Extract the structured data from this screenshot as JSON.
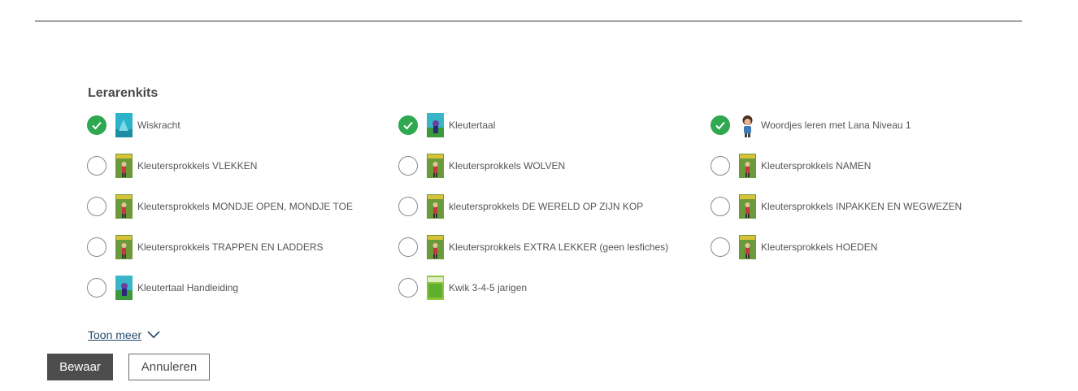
{
  "section": {
    "title": "Lerarenkits"
  },
  "kits": [
    {
      "label": "Wiskracht",
      "checked": true,
      "icon": "wiskracht-cover-icon",
      "cover": "teal"
    },
    {
      "label": "Kleutertaal",
      "checked": true,
      "icon": "kleutertaal-cover-icon",
      "cover": "teal-green"
    },
    {
      "label": "Woordjes leren met Lana Niveau 1",
      "checked": true,
      "icon": "lana-character-icon",
      "cover": "character"
    },
    {
      "label": "Kleutersprokkels VLEKKEN",
      "checked": false,
      "icon": "kleutersprokkels-cover-icon",
      "cover": "sprokkels"
    },
    {
      "label": "Kleutersprokkels WOLVEN",
      "checked": false,
      "icon": "kleutersprokkels-cover-icon",
      "cover": "sprokkels"
    },
    {
      "label": "Kleutersprokkels NAMEN",
      "checked": false,
      "icon": "kleutersprokkels-cover-icon",
      "cover": "sprokkels"
    },
    {
      "label": "Kleutersprokkels MONDJE OPEN, MONDJE TOE",
      "checked": false,
      "icon": "kleutersprokkels-cover-icon",
      "cover": "sprokkels"
    },
    {
      "label": "kleutersprokkels DE WERELD OP ZIJN KOP",
      "checked": false,
      "icon": "kleutersprokkels-cover-icon",
      "cover": "sprokkels"
    },
    {
      "label": "Kleutersprokkels INPAKKEN EN WEGWEZEN",
      "checked": false,
      "icon": "kleutersprokkels-cover-icon",
      "cover": "sprokkels"
    },
    {
      "label": "Kleutersprokkels TRAPPEN EN LADDERS",
      "checked": false,
      "icon": "kleutersprokkels-cover-icon",
      "cover": "sprokkels"
    },
    {
      "label": "Kleutersprokkels EXTRA LEKKER (geen lesfiches)",
      "checked": false,
      "icon": "kleutersprokkels-cover-icon",
      "cover": "sprokkels"
    },
    {
      "label": "Kleutersprokkels HOEDEN",
      "checked": false,
      "icon": "kleutersprokkels-cover-icon",
      "cover": "sprokkels"
    },
    {
      "label": "Kleutertaal Handleiding",
      "checked": false,
      "icon": "kleutertaal-handleiding-cover-icon",
      "cover": "teal-green"
    },
    {
      "label": "Kwik 3-4-5 jarigen",
      "checked": false,
      "icon": "kwik-cover-icon",
      "cover": "green"
    }
  ],
  "toon_meer": {
    "label": "Toon meer",
    "icon": "chevron-down-icon"
  },
  "buttons": {
    "save": "Bewaar",
    "cancel": "Annuleren"
  },
  "colors": {
    "checked": "#2fa850",
    "primary_button": "#4d4d4d",
    "link": "#24496e"
  }
}
